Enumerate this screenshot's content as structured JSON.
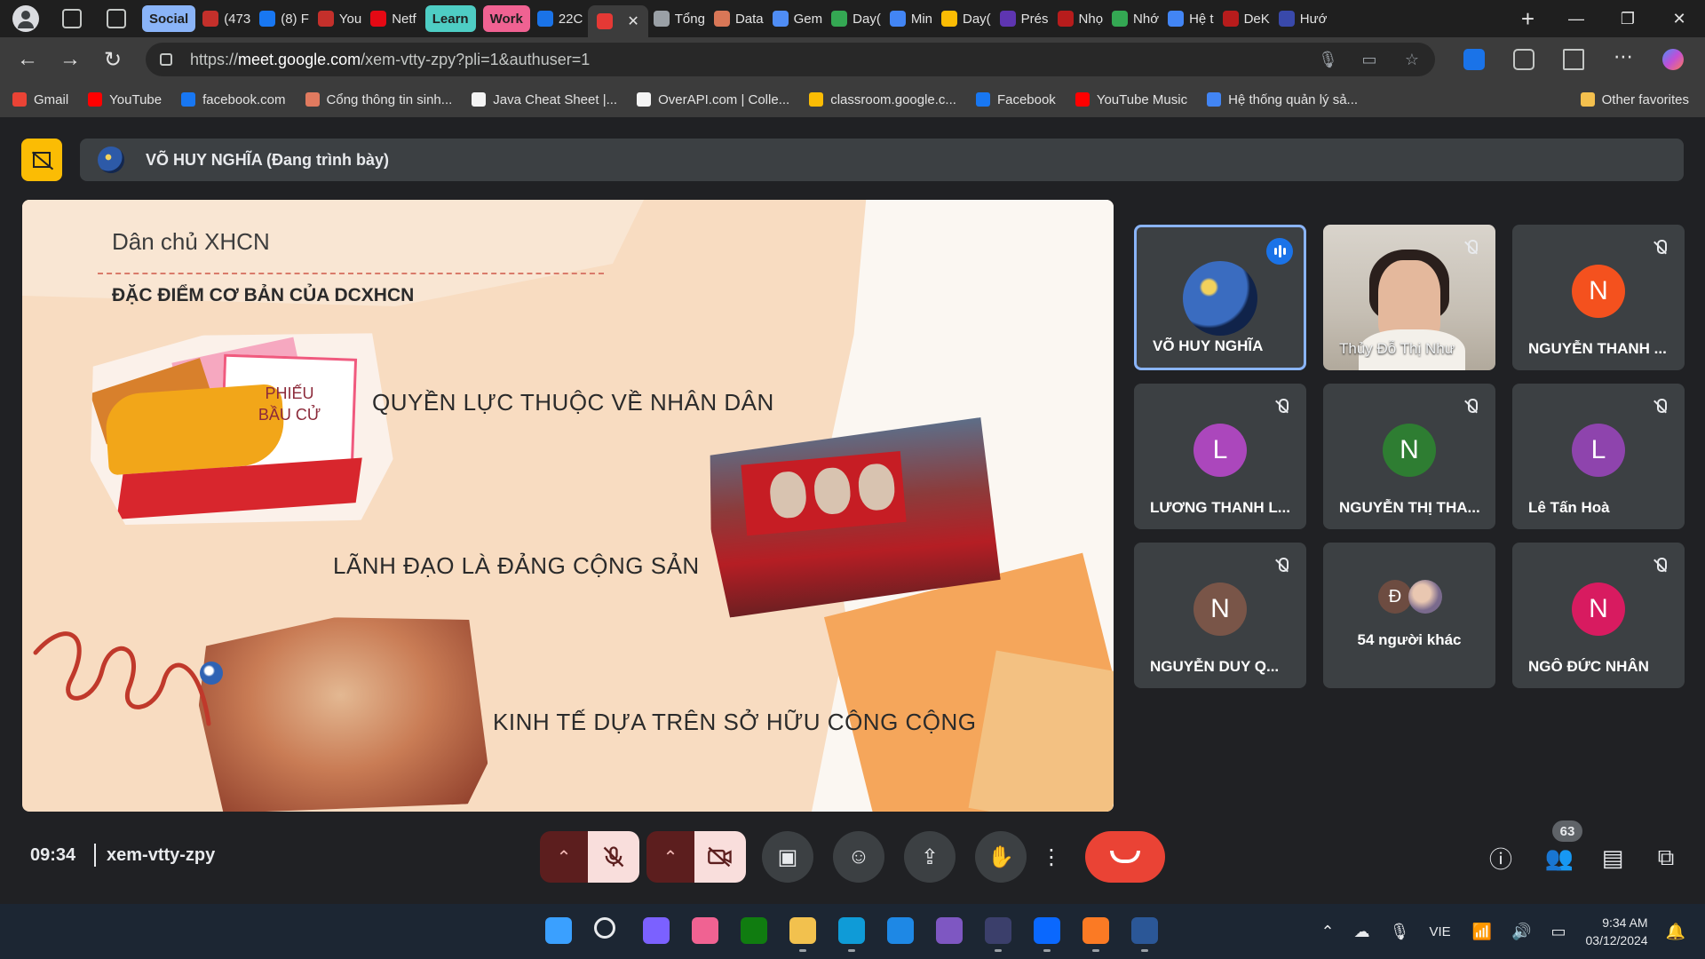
{
  "browser": {
    "tabs": [
      {
        "label": "Social",
        "type": "group",
        "color": "#8ab4f8"
      },
      {
        "label": "(473",
        "fav": "#c4302b"
      },
      {
        "label": "(8) F",
        "fav": "#1877f2"
      },
      {
        "label": "You",
        "fav": "#c4302b"
      },
      {
        "label": "Netf",
        "fav": "#e50914"
      },
      {
        "label": "Learn",
        "type": "group",
        "color": "#4ecdc4"
      },
      {
        "label": "Work",
        "type": "group",
        "color": "#f06292"
      },
      {
        "label": "22C",
        "fav": "#1a73e8"
      },
      {
        "label": "",
        "fav": "#e53935",
        "active": true,
        "close": "✕"
      },
      {
        "label": "Tổng",
        "fav": "#9aa0a6"
      },
      {
        "label": "Data",
        "fav": "#d97757"
      },
      {
        "label": "Gem",
        "fav": "#4f8df5"
      },
      {
        "label": "Day(",
        "fav": "#34a853"
      },
      {
        "label": "Min",
        "fav": "#4285f4"
      },
      {
        "label": "Day(",
        "fav": "#fbbc04"
      },
      {
        "label": "Prés",
        "fav": "#5e35b1"
      },
      {
        "label": "Nhọ",
        "fav": "#b71c1c"
      },
      {
        "label": "Nhớ",
        "fav": "#34a853"
      },
      {
        "label": "Hệ t",
        "fav": "#4285f4"
      },
      {
        "label": "DeK",
        "fav": "#b71c1c"
      },
      {
        "label": "Hướ",
        "fav": "#3949ab"
      }
    ],
    "new_tab": "+",
    "window_controls": {
      "minimize": "—",
      "maximize": "❐",
      "close": "✕"
    },
    "url_prefix": "https://",
    "url_host": "meet.google.com",
    "url_path": "/xem-vtty-zpy?pli=1&authuser=1",
    "bookmarks": [
      {
        "label": "Gmail",
        "color": "#ea4335"
      },
      {
        "label": "YouTube",
        "color": "#ff0000"
      },
      {
        "label": "facebook.com",
        "color": "#1877f2"
      },
      {
        "label": "Cổng thông tin sinh...",
        "color": "#e07a5f"
      },
      {
        "label": "Java Cheat Sheet |...",
        "color": "#f4f4f4"
      },
      {
        "label": "OverAPI.com | Colle...",
        "color": "#f4f4f4"
      },
      {
        "label": "classroom.google.c...",
        "color": "#fbbc04"
      },
      {
        "label": "Facebook",
        "color": "#1877f2"
      },
      {
        "label": "YouTube Music",
        "color": "#ff0000"
      },
      {
        "label": "Hệ thống quản lý sả...",
        "color": "#4285f4"
      }
    ],
    "other_favorites": "Other favorites"
  },
  "meet": {
    "presenter_label": "VÕ HUY NGHĨA (Đang trình bày)",
    "slide": {
      "title": "Dân chủ XHCN",
      "subtitle": "ĐẶC ĐIỂM CƠ BẢN CỦA  DCXHCN",
      "ballot_line1": "PHIẾU",
      "ballot_line2": "BẦU CỬ",
      "points": [
        "QUYỀN LỰC THUỘC VỀ NHÂN DÂN",
        "LÃNH ĐẠO LÀ ĐẢNG CỘNG SẢN",
        "KINH TẾ DỰA TRÊN SỞ HỮU CÔNG CỘNG"
      ]
    },
    "participants": [
      {
        "name": "VÕ HUY NGHĨA",
        "initial": "",
        "color": "#1b3a6b",
        "speaking": true,
        "muted": false
      },
      {
        "name": "Thủy Đỗ Thị Như",
        "initial": "",
        "color": "",
        "video": true,
        "muted": true
      },
      {
        "name": "NGUYỄN THANH ...",
        "initial": "N",
        "color": "#f4511e",
        "muted": true
      },
      {
        "name": "LƯƠNG THANH L...",
        "initial": "L",
        "color": "#ab47bc",
        "muted": true
      },
      {
        "name": "NGUYỄN THỊ THA...",
        "initial": "N",
        "color": "#2e7d32",
        "muted": true
      },
      {
        "name": "Lê Tấn Hoà",
        "initial": "L",
        "color": "#8e44ad",
        "muted": true
      },
      {
        "name": "NGUYỄN DUY Q...",
        "initial": "N",
        "color": "#795548",
        "muted": true
      },
      {
        "name": "54 người khác",
        "initial": "Đ",
        "color": "#6d4c41",
        "others": true
      },
      {
        "name": "NGÔ ĐỨC NHÂN",
        "initial": "N",
        "color": "#d81b60",
        "muted": true
      }
    ],
    "time": "09:34",
    "meeting_code": "xem-vtty-zpy",
    "people_count": "63",
    "accent_end_call": "#ea4335"
  },
  "taskbar": {
    "apps": [
      {
        "name": "windows-start-icon",
        "color": "#3aa0ff"
      },
      {
        "name": "search-icon",
        "color": "transparent"
      },
      {
        "name": "meet-app-icon",
        "color": "#7b61ff"
      },
      {
        "name": "copilot-icon",
        "color": "#f06292"
      },
      {
        "name": "xbox-icon",
        "color": "#107c10"
      },
      {
        "name": "file-explorer-icon",
        "color": "#f2c14e",
        "running": true
      },
      {
        "name": "edge-icon",
        "color": "#0f9bd7",
        "running": true
      },
      {
        "name": "vscode-icon",
        "color": "#1e88e5"
      },
      {
        "name": "visual-studio-icon",
        "color": "#7e57c2"
      },
      {
        "name": "eclipse-icon",
        "color": "#3b3f6b",
        "running": true
      },
      {
        "name": "zalo-icon",
        "color": "#0a68fe",
        "running": true
      },
      {
        "name": "xampp-icon",
        "color": "#fb7a24",
        "running": true
      },
      {
        "name": "terminal-app-icon",
        "color": "#2b5797",
        "running": true
      }
    ],
    "lang": "VIE",
    "clock_time": "9:34 AM",
    "clock_date": "03/12/2024"
  }
}
